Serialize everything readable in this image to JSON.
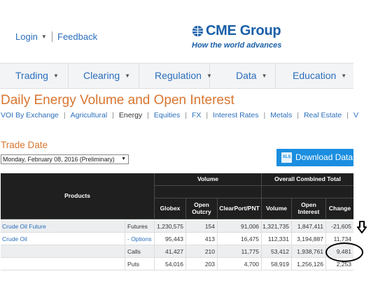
{
  "header": {
    "login": "Login",
    "feedback": "Feedback",
    "brand": "CME Group",
    "tagline": "How the world advances"
  },
  "nav": {
    "items": [
      {
        "label": "Trading"
      },
      {
        "label": "Clearing"
      },
      {
        "label": "Regulation"
      },
      {
        "label": "Data"
      },
      {
        "label": "Education"
      }
    ]
  },
  "page": {
    "title": "Daily Energy Volume and Open Interest",
    "subnav": [
      "VOI By Exchange",
      "Agricultural",
      "Energy",
      "Equities",
      "FX",
      "Interest Rates",
      "Metals",
      "Real Estate",
      "V"
    ],
    "current_subnav": "Energy",
    "trade_date_label": "Trade Date",
    "trade_date_value": "Monday, February 08, 2016 (Preliminary)",
    "download_label": "Download Data",
    "download_icon_text": "XLS"
  },
  "table": {
    "headers": {
      "products": "Products",
      "volume": "Volume",
      "overall": "Overall Combined Total",
      "globex": "Globex",
      "open_outcry_1": "Open",
      "open_outcry_2": "Outcry",
      "clearport": "ClearPort/PNT",
      "total_volume": "Volume",
      "open_interest_1": "Open",
      "open_interest_2": "Interest",
      "change": "Change"
    },
    "rows": [
      {
        "product": "Crude Oil Future",
        "type": "Futures",
        "globex": "1,230,575",
        "outcry": "154",
        "clearport": "91,006",
        "volume": "1,321,735",
        "oi": "1,847,411",
        "change": "-21,605"
      },
      {
        "product": "Crude Oil",
        "type": "- Options",
        "globex": "95,443",
        "outcry": "413",
        "clearport": "16,475",
        "volume": "112,331",
        "oi": "3,194,887",
        "change": "11,734"
      },
      {
        "product": "",
        "type": "Calls",
        "globex": "41,427",
        "outcry": "210",
        "clearport": "11,775",
        "volume": "53,412",
        "oi": "1,938,761",
        "change": "9,481"
      },
      {
        "product": "",
        "type": "Puts",
        "globex": "54,016",
        "outcry": "203",
        "clearport": "4,700",
        "volume": "58,919",
        "oi": "1,256,126",
        "change": "2,253"
      }
    ]
  },
  "colors": {
    "brand_blue": "#1a5fa8",
    "link_blue": "#2a6ebb",
    "title_orange": "#d8752f",
    "header_dark": "#1f1f1f",
    "button_blue": "#1b8ee0"
  },
  "icons": {
    "logo": "globe-logo-icon",
    "download": "xls-file-icon",
    "annotation_arrow": "down-arrow-icon",
    "annotation_circle": "highlight-ellipse"
  }
}
